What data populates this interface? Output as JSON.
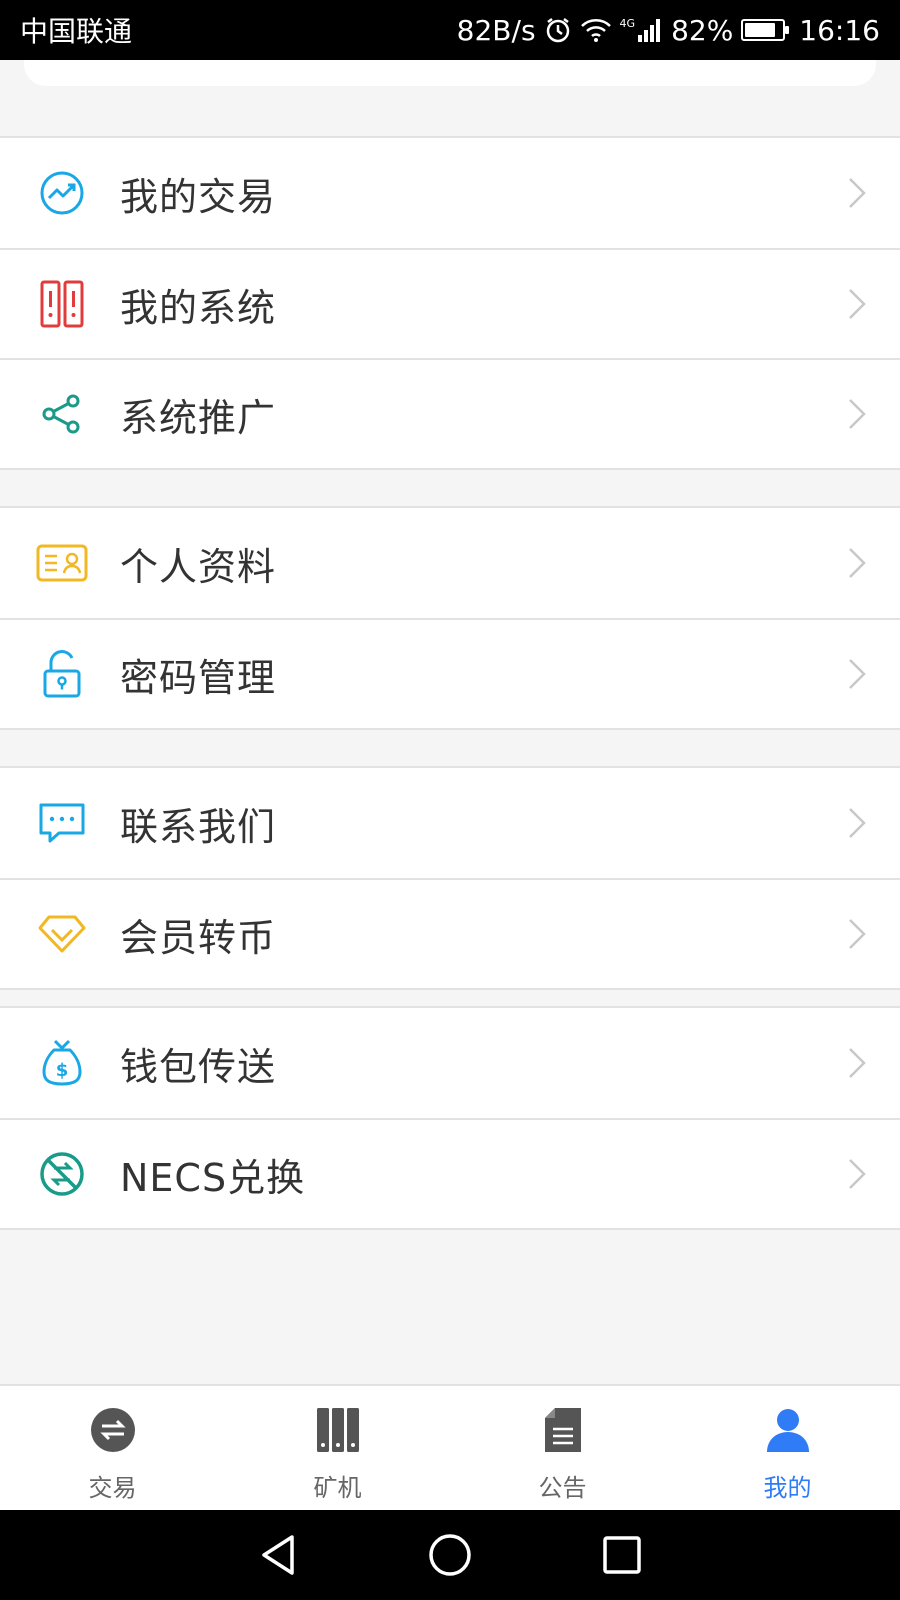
{
  "status_bar": {
    "carrier": "中国联通",
    "speed": "82B/s",
    "network": "4G",
    "battery": "82%",
    "battery_level": 0.82,
    "time": "16:16"
  },
  "menu": {
    "section1": [
      {
        "label": "我的交易",
        "icon": "trend-chart-icon",
        "color": "#1aa7e6"
      },
      {
        "label": "我的系统",
        "icon": "server-rack-icon",
        "color": "#e23b3b"
      },
      {
        "label": "系统推广",
        "icon": "share-icon",
        "color": "#1a9b8a"
      }
    ],
    "section2": [
      {
        "label": "个人资料",
        "icon": "id-card-icon",
        "color": "#f2b824"
      },
      {
        "label": "密码管理",
        "icon": "lock-icon",
        "color": "#1aa7e6"
      }
    ],
    "section3": [
      {
        "label": "联系我们",
        "icon": "chat-bubble-icon",
        "color": "#1aa7e6"
      },
      {
        "label": "会员转币",
        "icon": "diamond-icon",
        "color": "#f2b824"
      }
    ],
    "section4": [
      {
        "label": "钱包传送",
        "icon": "money-bag-icon",
        "color": "#1aa7e6"
      },
      {
        "label": "NECS兑换",
        "icon": "exchange-icon",
        "color": "#1a9b8a"
      }
    ]
  },
  "tabs": [
    {
      "label": "交易",
      "icon": "exchange-circle-icon",
      "active": false
    },
    {
      "label": "矿机",
      "icon": "miner-icon",
      "active": false
    },
    {
      "label": "公告",
      "icon": "document-icon",
      "active": false
    },
    {
      "label": "我的",
      "icon": "user-icon",
      "active": true
    }
  ],
  "colors": {
    "accent": "#2f7cf6",
    "inactive_tab": "#666666"
  }
}
